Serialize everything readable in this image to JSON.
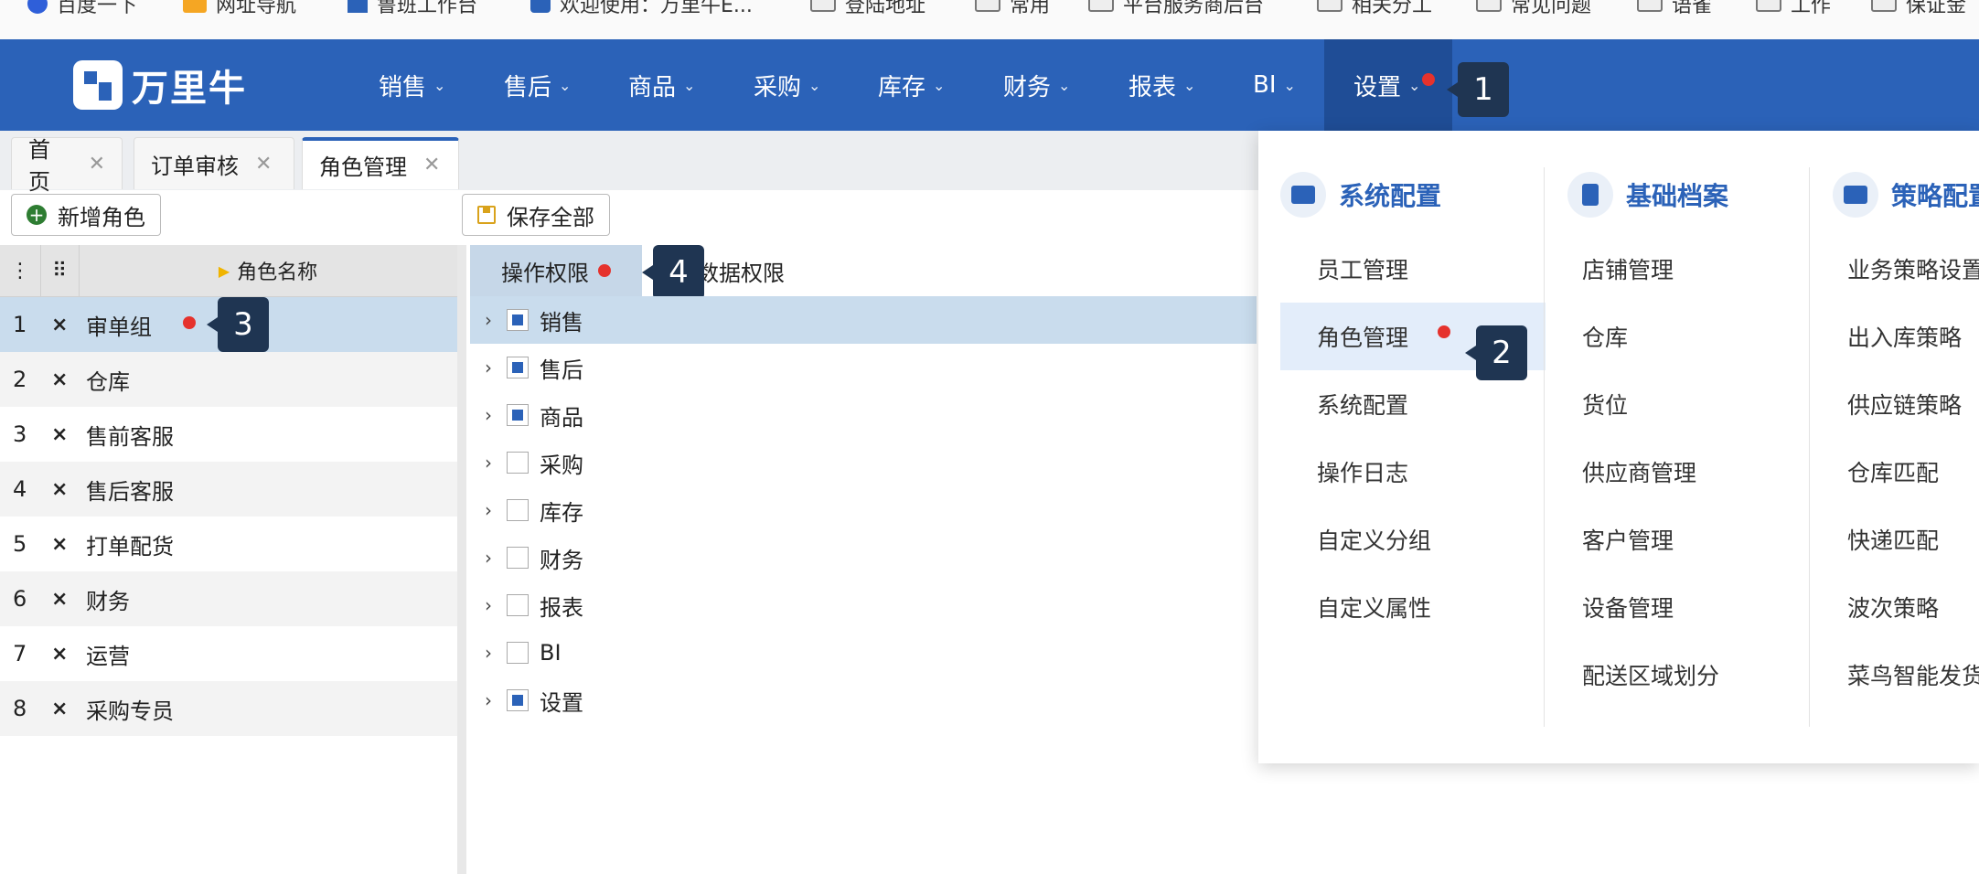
{
  "bookmarks": [
    {
      "label": "百度一下"
    },
    {
      "label": "网址导航"
    },
    {
      "label": "鲁班工作台"
    },
    {
      "label": "欢迎使用：万里牛E..."
    },
    {
      "label": "登陆地址"
    },
    {
      "label": "常用"
    },
    {
      "label": "平台服务商后台"
    },
    {
      "label": "相关分工"
    },
    {
      "label": "常见问题"
    },
    {
      "label": "语雀"
    },
    {
      "label": "工作"
    },
    {
      "label": "保证金"
    }
  ],
  "brand": {
    "name": "万里牛",
    "color": "#2b62b8"
  },
  "nav": [
    {
      "label": "销售"
    },
    {
      "label": "售后"
    },
    {
      "label": "商品"
    },
    {
      "label": "采购"
    },
    {
      "label": "库存"
    },
    {
      "label": "财务"
    },
    {
      "label": "报表"
    },
    {
      "label": "BI"
    },
    {
      "label": "设置"
    }
  ],
  "markers": {
    "m1": "1",
    "m2": "2",
    "m3": "3",
    "m4": "4"
  },
  "tabs": [
    {
      "label": "首页",
      "close": "✕"
    },
    {
      "label": "订单审核",
      "close": "✕"
    },
    {
      "label": "角色管理",
      "close": "✕"
    }
  ],
  "toolbar": {
    "add_role": "新增角色",
    "save_all": "保存全部"
  },
  "roles": {
    "header": {
      "name_col": "角色名称"
    },
    "rows": [
      {
        "num": "1",
        "del": "×",
        "name": "审单组"
      },
      {
        "num": "2",
        "del": "×",
        "name": "仓库"
      },
      {
        "num": "3",
        "del": "×",
        "name": "售前客服"
      },
      {
        "num": "4",
        "del": "×",
        "name": "售后客服"
      },
      {
        "num": "5",
        "del": "×",
        "name": "打单配货"
      },
      {
        "num": "6",
        "del": "×",
        "name": "财务"
      },
      {
        "num": "7",
        "del": "×",
        "name": "运营"
      },
      {
        "num": "8",
        "del": "×",
        "name": "采购专员"
      }
    ]
  },
  "perm_tabs": {
    "operation": "操作权限",
    "data": "数据权限"
  },
  "perm_tree": [
    {
      "label": "销售",
      "checked": true
    },
    {
      "label": "售后",
      "checked": true
    },
    {
      "label": "商品",
      "checked": true
    },
    {
      "label": "采购",
      "checked": false
    },
    {
      "label": "库存",
      "checked": false
    },
    {
      "label": "财务",
      "checked": false
    },
    {
      "label": "报表",
      "checked": false
    },
    {
      "label": "BI",
      "checked": false
    },
    {
      "label": "设置",
      "checked": true
    }
  ],
  "dropdown": {
    "system": {
      "title": "系统配置",
      "items": [
        "员工管理",
        "角色管理",
        "系统配置",
        "操作日志",
        "自定义分组",
        "自定义属性"
      ]
    },
    "basic": {
      "title": "基础档案",
      "items": [
        "店铺管理",
        "仓库",
        "货位",
        "供应商管理",
        "客户管理",
        "设备管理",
        "配送区域划分"
      ]
    },
    "strategy": {
      "title": "策略配置",
      "items": [
        "业务策略设置",
        "出入库策略",
        "供应链策略",
        "仓库匹配",
        "快递匹配",
        "波次策略",
        "菜鸟智能发货"
      ]
    }
  },
  "colors": {
    "nav_bg": "#2b62b8",
    "selected_row": "#c9dced",
    "marker_dot": "#e5322d"
  }
}
